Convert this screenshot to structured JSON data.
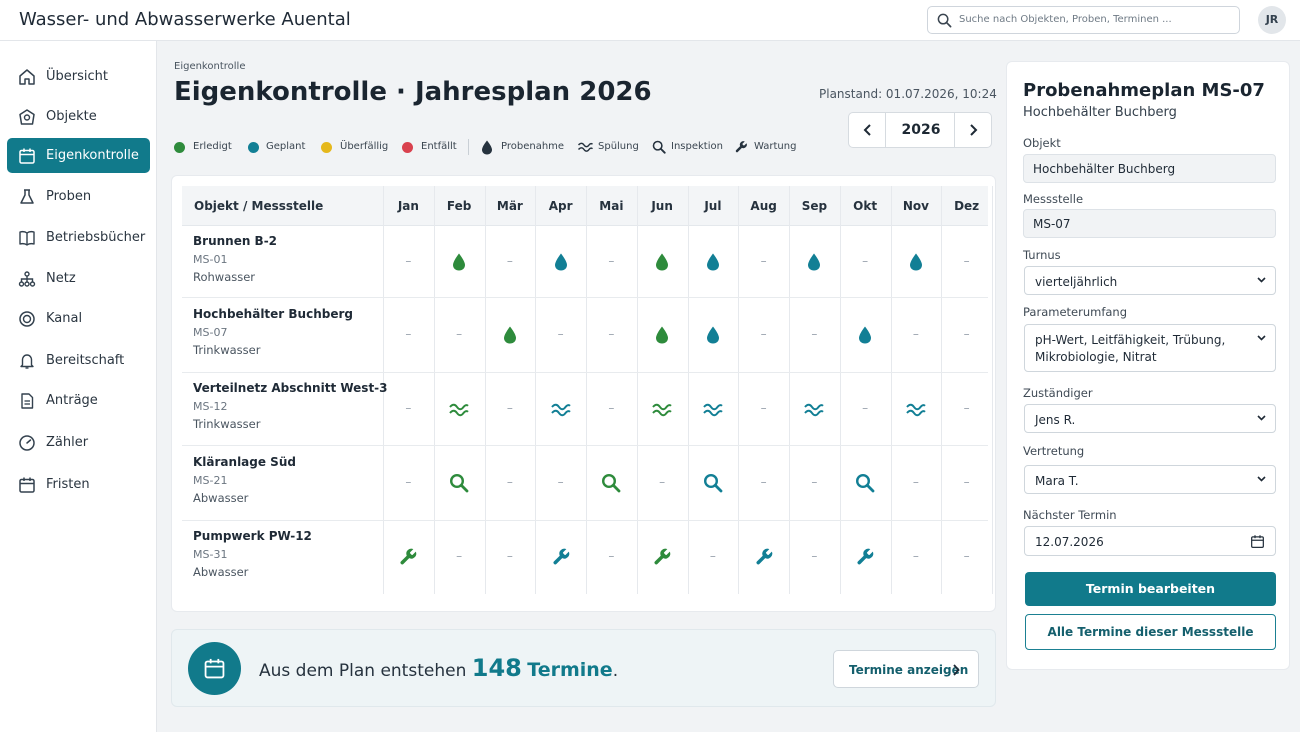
{
  "app": {
    "title": "Wasser- und Abwasserwerke Auental",
    "user_initials": "JR"
  },
  "search": {
    "placeholder": "Suche nach Objekten, Proben, Terminen ..."
  },
  "sidebar": {
    "items": [
      {
        "label": "Übersicht",
        "icon": "home-icon"
      },
      {
        "label": "Objekte",
        "icon": "building-icon"
      },
      {
        "label": "Eigenkontrolle",
        "icon": "calendar-icon",
        "active": true
      },
      {
        "label": "Proben",
        "icon": "flask-icon"
      },
      {
        "label": "Betriebsbücher",
        "icon": "book-icon"
      },
      {
        "label": "Netz",
        "icon": "network-icon"
      },
      {
        "label": "Kanal",
        "icon": "pipe-icon"
      },
      {
        "label": "Bereitschaft",
        "icon": "bell-icon"
      },
      {
        "label": "Anträge",
        "icon": "document-icon"
      },
      {
        "label": "Zähler",
        "icon": "meter-icon"
      },
      {
        "label": "Fristen",
        "icon": "deadline-icon"
      }
    ]
  },
  "page": {
    "breadcrumb": "Eigenkontrolle",
    "title": "Eigenkontrolle · Jahresplan 2026",
    "planstand": "Planstand: 01.07.2026, 10:24",
    "year": "2026"
  },
  "legend": {
    "statuses": [
      {
        "label": "Erledigt",
        "color": "#2e8b3c"
      },
      {
        "label": "Geplant",
        "color": "#127f95"
      },
      {
        "label": "Überfällig",
        "color": "#e5b81c"
      },
      {
        "label": "Entfällt",
        "color": "#d9414e"
      }
    ],
    "types": [
      {
        "label": "Probenahme",
        "icon": "drop-icon"
      },
      {
        "label": "Spülung",
        "icon": "waves-icon"
      },
      {
        "label": "Inspektion",
        "icon": "magnifier-icon"
      },
      {
        "label": "Wartung",
        "icon": "wrench-icon"
      }
    ]
  },
  "plan": {
    "header": "Objekt / Messstelle",
    "months": [
      "Jan",
      "Feb",
      "Mär",
      "Apr",
      "Mai",
      "Jun",
      "Jul",
      "Aug",
      "Sep",
      "Okt",
      "Nov",
      "Dez"
    ],
    "rows": [
      {
        "name": "Brunnen B-2",
        "code": "MS-01",
        "type": "Rohwasser",
        "activity": "drop",
        "cells": [
          "-",
          "done",
          "-",
          "planned",
          "-",
          "done",
          "planned",
          "-",
          "planned",
          "-",
          "planned",
          "-"
        ]
      },
      {
        "name": "Hochbehälter Buchberg",
        "code": "MS-07",
        "type": "Trinkwasser",
        "activity": "drop",
        "cells": [
          "-",
          "-",
          "done",
          "-",
          "-",
          "done",
          "planned",
          "-",
          "-",
          "planned",
          "-",
          "-"
        ]
      },
      {
        "name": "Verteilnetz Abschnitt West-3",
        "code": "MS-12",
        "type": "Trinkwasser",
        "activity": "waves",
        "cells": [
          "-",
          "done",
          "-",
          "planned",
          "-",
          "done",
          "planned",
          "-",
          "planned",
          "-",
          "planned",
          "-"
        ]
      },
      {
        "name": "Kläranlage Süd",
        "code": "MS-21",
        "type": "Abwasser",
        "activity": "search",
        "cells": [
          "-",
          "done",
          "-",
          "-",
          "done",
          "-",
          "planned",
          "-",
          "-",
          "planned",
          "-",
          "-"
        ]
      },
      {
        "name": "Pumpwerk PW-12",
        "code": "MS-31",
        "type": "Abwasser",
        "activity": "wrench",
        "cells": [
          "done",
          "-",
          "-",
          "planned",
          "-",
          "done",
          "-",
          "planned",
          "-",
          "planned",
          "-",
          "-"
        ]
      }
    ]
  },
  "summary": {
    "prefix": "Aus dem Plan entstehen",
    "count": "148",
    "unit": "Termine",
    "suffix": ".",
    "button": "Termine anzeigen"
  },
  "panel": {
    "title": "Probenahmeplan MS-07",
    "subtitle": "Hochbehälter Buchberg",
    "objekt_label": "Objekt",
    "objekt_value": "Hochbehälter Buchberg",
    "messstelle_label": "Messstelle",
    "messstelle_value": "MS-07",
    "turnus_label": "Turnus",
    "turnus_value": "vierteljährlich",
    "parameter_label": "Parameterumfang",
    "parameter_value": "pH-Wert, Leitfähigkeit, Trübung, Mikrobiologie, Nitrat",
    "zustaendig_label": "Zuständiger",
    "zustaendig_value": "Jens R.",
    "vertretung_label": "Vertretung",
    "vertretung_value": "Mara T.",
    "termin_label": "Nächster Termin",
    "termin_value": "12.07.2026",
    "primary_button": "Termin bearbeiten",
    "secondary_button": "Alle Termine dieser Messstelle"
  }
}
